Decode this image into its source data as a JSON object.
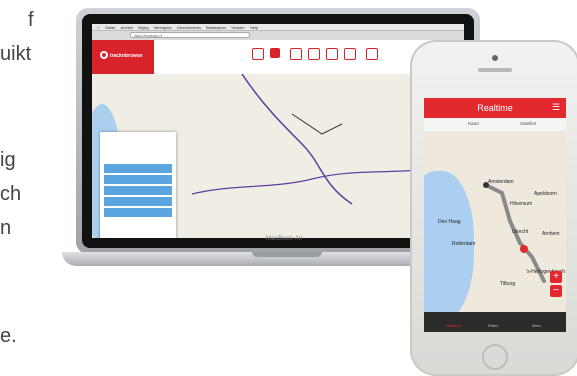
{
  "side_text": {
    "lines": [
      "f",
      "uikt",
      "ig",
      "ch",
      "n",
      "e."
    ]
  },
  "laptop": {
    "brand": "MacBook Air",
    "browser_menu": [
      "Safari",
      "Archief",
      "Wijzig",
      "Weergave",
      "Geschiedenis",
      "Bladwijzers",
      "Venster",
      "Help"
    ],
    "url": "https://bootlogic.nl",
    "app_logo": "tracknbrowse"
  },
  "phone": {
    "title": "Realtime",
    "tabs": [
      "Kaart",
      "Satelliet"
    ],
    "zoom_in": "+",
    "zoom_out": "−",
    "cities": [
      "Amsterdam",
      "Den Haag",
      "Rotterdam",
      "Hilversum",
      "Utrecht",
      "Arnhem",
      "Tilburg",
      "'s-Hertogenbosch",
      "Apeldoorn"
    ],
    "footer": [
      "Realtime",
      "Ritten",
      "Meer"
    ]
  },
  "colors": {
    "brand_red": "#e3282e",
    "route_purple": "#5a3fa0",
    "route_grey": "#8a8a8a",
    "sea_blue": "#abd0f0",
    "panel_blue": "#5ba6e0"
  }
}
